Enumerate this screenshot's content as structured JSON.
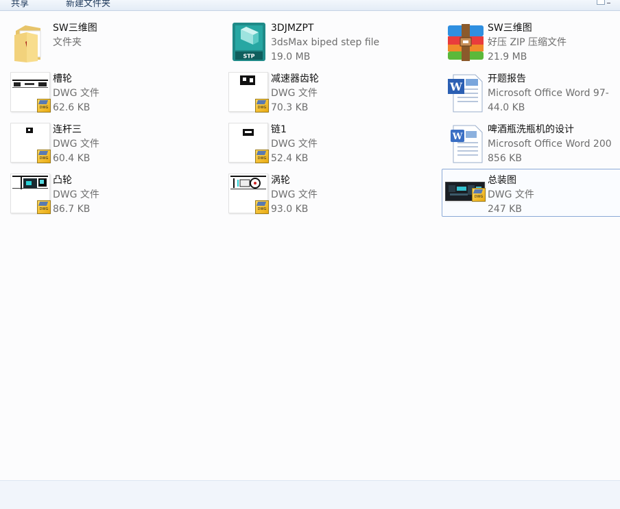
{
  "toolbar": {
    "share_label": "共享",
    "new_folder_label": "新建文件夹"
  },
  "files": [
    {
      "name": "SW三维图",
      "type": "文件夹",
      "size": "",
      "icon": "folder-icon"
    },
    {
      "name": "3DJMZPT",
      "type": "3dsMax biped step file",
      "size": "19.0 MB",
      "icon": "stp-file-icon"
    },
    {
      "name": "SW三维图",
      "type": "好压 ZIP 压缩文件",
      "size": "21.9 MB",
      "icon": "zip-archive-icon"
    },
    {
      "name": "槽轮",
      "type": "DWG 文件",
      "size": "62.6 KB",
      "icon": "dwg-thumbnail-icon"
    },
    {
      "name": "减速器齿轮",
      "type": "DWG 文件",
      "size": "70.3 KB",
      "icon": "dwg-thumbnail-icon"
    },
    {
      "name": "开题报告",
      "type": "Microsoft Office Word 97-",
      "size": "44.0 KB",
      "icon": "word-doc-icon"
    },
    {
      "name": "连杆三",
      "type": "DWG 文件",
      "size": "60.4 KB",
      "icon": "dwg-thumbnail-icon"
    },
    {
      "name": "链1",
      "type": "DWG 文件",
      "size": "52.4 KB",
      "icon": "dwg-thumbnail-icon"
    },
    {
      "name": "啤酒瓶洗瓶机的设计",
      "type": "Microsoft Office Word 200",
      "size": "856 KB",
      "icon": "word-docx-icon"
    },
    {
      "name": "凸轮",
      "type": "DWG 文件",
      "size": "86.7 KB",
      "icon": "dwg-thumbnail-icon"
    },
    {
      "name": "涡轮",
      "type": "DWG 文件",
      "size": "93.0 KB",
      "icon": "dwg-thumbnail-icon"
    },
    {
      "name": "总装图",
      "type": "DWG 文件",
      "size": "247 KB",
      "icon": "dwg-thumbnail-icon",
      "selected": true
    }
  ],
  "colors": {
    "selection_border": "#8aa9d6",
    "secondary_text": "#6d6d6d",
    "toolbar_text": "#1e395b"
  }
}
